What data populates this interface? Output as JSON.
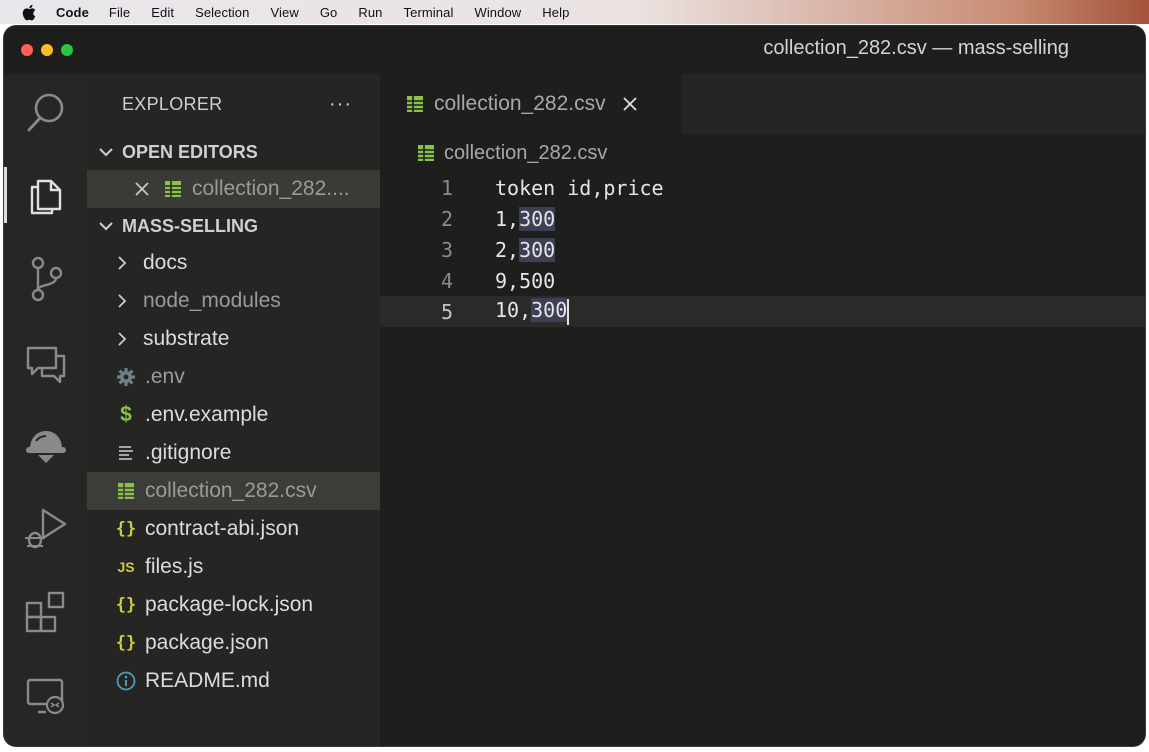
{
  "menubar": {
    "app_name": "Code",
    "items": [
      "File",
      "Edit",
      "Selection",
      "View",
      "Go",
      "Run",
      "Terminal",
      "Window",
      "Help"
    ]
  },
  "window": {
    "title": "collection_282.csv — mass-selling"
  },
  "activity_bar": {
    "icons": [
      "search-icon",
      "explorer-icon",
      "source-control-icon",
      "comments-icon",
      "extension-helmet-icon",
      "run-debug-icon",
      "extensions-icon",
      "remote-explorer-icon"
    ],
    "active": "explorer-icon"
  },
  "sidebar": {
    "title": "EXPLORER",
    "more": "···",
    "open_editors": {
      "header": "OPEN EDITORS",
      "items": [
        {
          "label": "collection_282...."
        }
      ]
    },
    "project": {
      "header": "MASS-SELLING",
      "folders": [
        {
          "label": "docs"
        },
        {
          "label": "node_modules"
        },
        {
          "label": "substrate"
        }
      ],
      "files": [
        {
          "label": ".env",
          "icon": "gear-icon"
        },
        {
          "label": ".env.example",
          "icon": "dollar-icon"
        },
        {
          "label": ".gitignore",
          "icon": "lines-icon"
        },
        {
          "label": "collection_282.csv",
          "icon": "table-icon"
        },
        {
          "label": "contract-abi.json",
          "icon": "braces-icon"
        },
        {
          "label": "files.js",
          "icon": "js-icon"
        },
        {
          "label": "package-lock.json",
          "icon": "braces-icon"
        },
        {
          "label": "package.json",
          "icon": "braces-icon"
        },
        {
          "label": "README.md",
          "icon": "info-icon"
        }
      ]
    }
  },
  "editor": {
    "tab_label": "collection_282.csv",
    "breadcrumb": "collection_282.csv",
    "lines": [
      {
        "n": "1",
        "a": "token id,price",
        "b": ""
      },
      {
        "n": "2",
        "a": "1,",
        "b": "300"
      },
      {
        "n": "3",
        "a": "2,",
        "b": "300"
      },
      {
        "n": "4",
        "a": "9,500",
        "b": ""
      },
      {
        "n": "5",
        "a": "10,",
        "b": "300"
      }
    ]
  },
  "colors": {
    "csv_icon": "#8bc34a",
    "json_icon": "#cbcb41",
    "js_icon": "#cbcb41",
    "info_icon": "#519aba",
    "env_icon": "#6d8086",
    "selection_highlight": "#3d3f55"
  }
}
